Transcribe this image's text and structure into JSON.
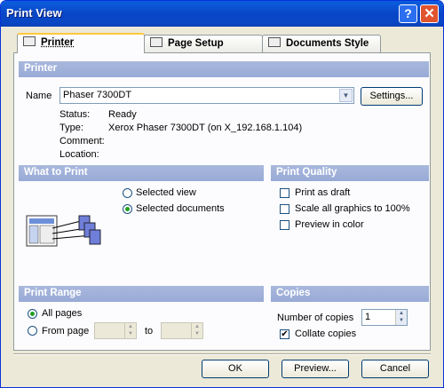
{
  "window": {
    "title": "Print View"
  },
  "title_buttons": {
    "help": "?",
    "close": "✕"
  },
  "tabs": [
    {
      "label": "Printer",
      "icon": "printer-icon"
    },
    {
      "label": "Page Setup",
      "icon": "page-setup-icon"
    },
    {
      "label": "Documents Style",
      "icon": "documents-style-icon"
    }
  ],
  "printer": {
    "section": "Printer",
    "name_label": "Name",
    "name_value": "Phaser 7300DT",
    "settings_button": "Settings...",
    "status_label": "Status:",
    "status_value": "Ready",
    "type_label": "Type:",
    "type_value": "Xerox Phaser 7300DT (on X_192.168.1.104)",
    "comment_label": "Comment:",
    "location_label": "Location:"
  },
  "what_to_print": {
    "section": "What to Print",
    "options": [
      "Selected view",
      "Selected documents"
    ],
    "selected": "Selected documents"
  },
  "print_quality": {
    "section": "Print Quality",
    "options": [
      {
        "label": "Print as draft",
        "checked": false
      },
      {
        "label": "Scale all graphics to 100%",
        "checked": false
      },
      {
        "label": "Preview in color",
        "checked": false
      }
    ]
  },
  "print_range": {
    "section": "Print Range",
    "all_pages": "All pages",
    "from_page": "From page",
    "to": "to",
    "selected": "All pages"
  },
  "copies": {
    "section": "Copies",
    "number_label": "Number of copies",
    "number_value": "1",
    "collate_label": "Collate copies",
    "collate_checked": true
  },
  "buttons": {
    "ok": "OK",
    "preview": "Preview...",
    "cancel": "Cancel"
  }
}
